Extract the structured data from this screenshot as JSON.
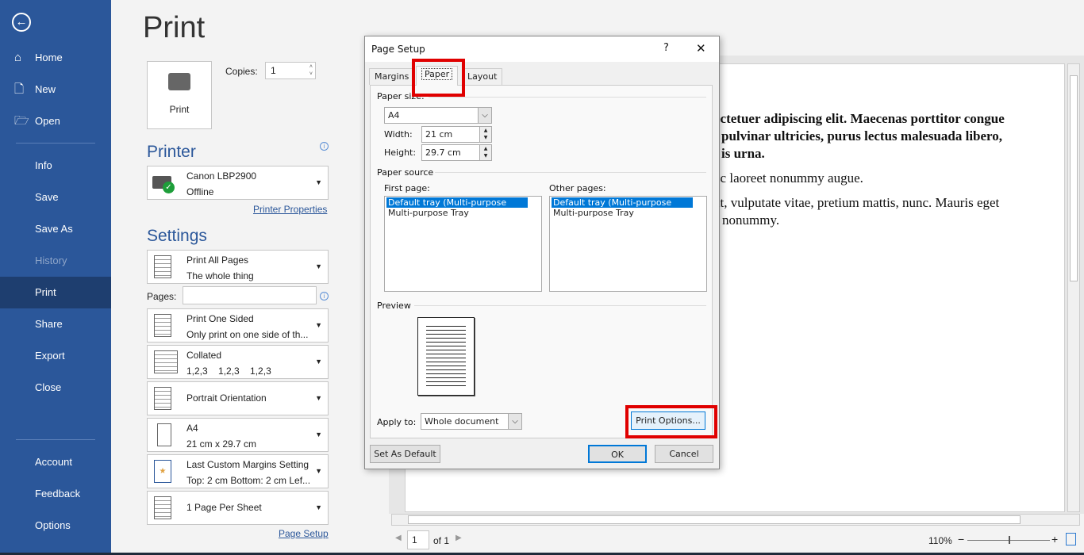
{
  "sidebar": {
    "back_icon": "arrow-left-circle-icon",
    "items": [
      {
        "label": "Home",
        "icon": "home-icon"
      },
      {
        "label": "New",
        "icon": "new-document-icon"
      },
      {
        "label": "Open",
        "icon": "folder-open-icon"
      },
      {
        "label": "Info"
      },
      {
        "label": "Save"
      },
      {
        "label": "Save As"
      },
      {
        "label": "History"
      },
      {
        "label": "Print"
      },
      {
        "label": "Share"
      },
      {
        "label": "Export"
      },
      {
        "label": "Close"
      },
      {
        "label": "Account"
      },
      {
        "label": "Feedback"
      },
      {
        "label": "Options"
      }
    ],
    "active": "Print",
    "color": "#2b579a"
  },
  "print": {
    "title": "Print",
    "print_button": "Print",
    "copies_label": "Copies:",
    "copies_value": "1",
    "printer_heading": "Printer",
    "printer_name": "Canon LBP2900",
    "printer_status": "Offline",
    "printer_properties": "Printer Properties",
    "settings_heading": "Settings",
    "pages_label": "Pages:",
    "pages_value": "",
    "settings": [
      {
        "line1": "Print All Pages",
        "line2": "The whole thing"
      },
      {
        "line1": "Print One Sided",
        "line2": "Only print on one side of th..."
      },
      {
        "line1": "Collated",
        "line2": "1,2,3    1,2,3    1,2,3"
      },
      {
        "line1": "Portrait Orientation",
        "line2": ""
      },
      {
        "line1": "A4",
        "line2": "21 cm x 29.7 cm"
      },
      {
        "line1": "Last Custom Margins Setting",
        "line2": "Top: 2 cm Bottom: 2 cm Lef..."
      },
      {
        "line1": "1 Page Per Sheet",
        "line2": ""
      }
    ],
    "page_setup_link": "Page Setup"
  },
  "document": {
    "lines": [
      "ectetuer adipiscing elit. Maecenas porttitor congue",
      "pulvinar ultricies, purus lectus malesuada libero,",
      "is urna.",
      "ec laoreet nonummy augue.",
      "at, vulputate vitae, pretium mattis, nunc. Mauris eget",
      "nonummy."
    ]
  },
  "footer": {
    "page_value": "1",
    "of_label": "of 1",
    "zoom": "110%",
    "zoom_minus": "−",
    "zoom_plus": "+"
  },
  "dialog": {
    "title": "Page Setup",
    "help": "?",
    "close": "✕",
    "tabs": [
      "Margins",
      "Paper",
      "Layout"
    ],
    "active_tab": "Paper",
    "paper_size_label": "Paper size:",
    "paper_size_value": "A4",
    "width_label": "Width:",
    "width_value": "21 cm",
    "height_label": "Height:",
    "height_value": "29.7 cm",
    "paper_source_label": "Paper source",
    "first_page_label": "First page:",
    "other_pages_label": "Other pages:",
    "first_page_options": [
      "Default tray (Multi-purpose Tray)",
      "Multi-purpose Tray"
    ],
    "other_pages_options": [
      "Default tray (Multi-purpose Tray)",
      "Multi-purpose Tray"
    ],
    "preview_label": "Preview",
    "apply_to_label": "Apply to:",
    "apply_to_value": "Whole document",
    "print_options": "Print Options...",
    "set_as_default": "Set As Default",
    "ok": "OK",
    "cancel": "Cancel",
    "highlight_color": "#e00000"
  }
}
